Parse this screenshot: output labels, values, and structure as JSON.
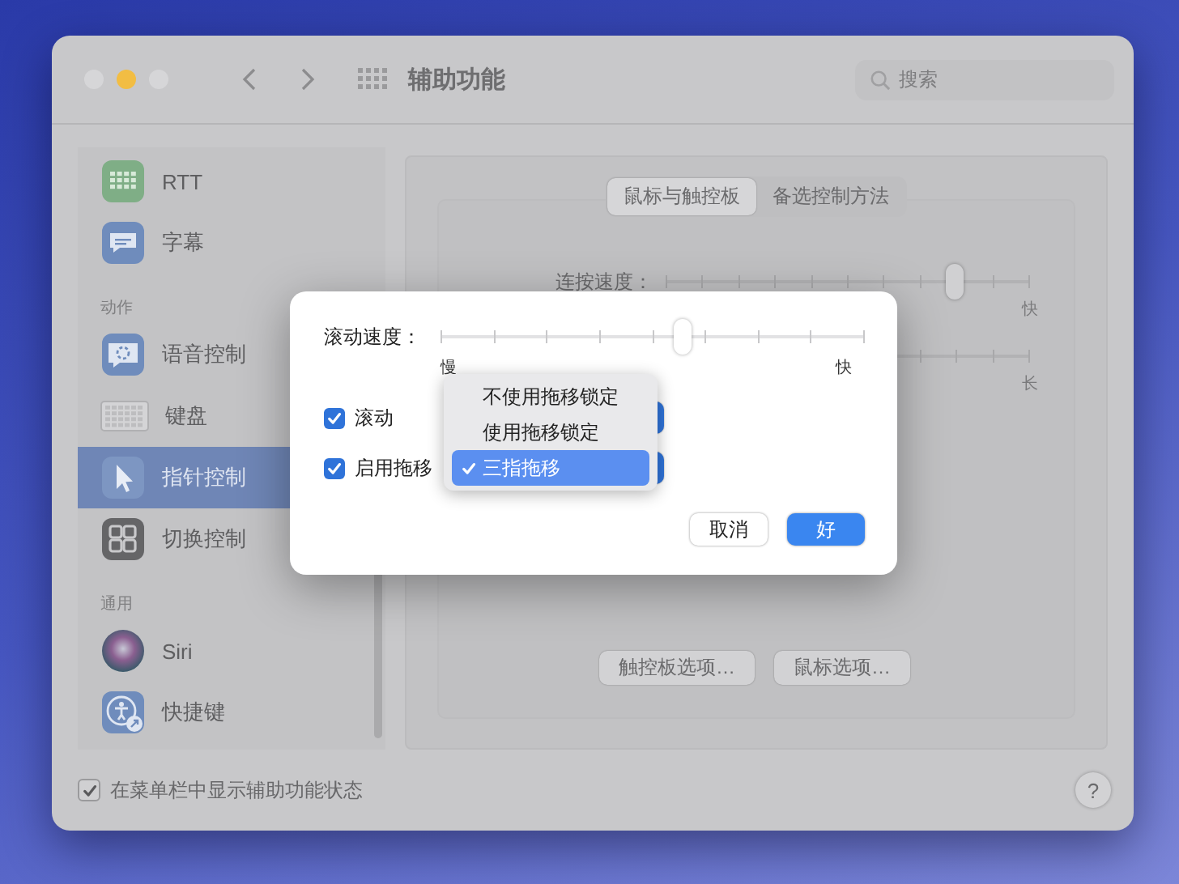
{
  "window": {
    "title": "辅助功能",
    "search": {
      "placeholder": "搜索"
    }
  },
  "sidebar": {
    "items": [
      {
        "kind": "item",
        "label": "RTT",
        "selected": false
      },
      {
        "kind": "item",
        "label": "字幕",
        "selected": false
      },
      {
        "kind": "header",
        "label": "动作"
      },
      {
        "kind": "item",
        "label": "语音控制",
        "selected": false
      },
      {
        "kind": "item",
        "label": "键盘",
        "selected": false
      },
      {
        "kind": "item",
        "label": "指针控制",
        "selected": true
      },
      {
        "kind": "item",
        "label": "切换控制",
        "selected": false
      },
      {
        "kind": "header",
        "label": "通用"
      },
      {
        "kind": "item",
        "label": "Siri",
        "selected": false
      },
      {
        "kind": "item",
        "label": "快捷键",
        "selected": false
      }
    ]
  },
  "panel": {
    "tabs": [
      {
        "label": "鼠标与触控板",
        "selected": true
      },
      {
        "label": "备选控制方法",
        "selected": false
      }
    ],
    "sliders": [
      {
        "label": "连按速度：",
        "level": 0.79,
        "end_label": "快"
      },
      {
        "end_label": "长"
      }
    ],
    "buttons": [
      "触控板选项…",
      "鼠标选项…"
    ]
  },
  "footer": {
    "checkbox": {
      "label": "在菜单栏中显示辅助功能状态",
      "checked": true
    },
    "help": "?"
  },
  "dialog": {
    "slider": {
      "label": "滚动速度：",
      "level": 0.57,
      "min_label": "慢",
      "max_label": "快"
    },
    "options": [
      {
        "label": "滚动",
        "checked": true
      },
      {
        "label": "启用拖移",
        "checked": true
      }
    ],
    "menu": [
      {
        "label": "不使用拖移锁定",
        "selected": false
      },
      {
        "label": "使用拖移锁定",
        "selected": false
      },
      {
        "label": "三指拖移",
        "selected": true
      }
    ],
    "buttons": [
      {
        "label": "取消",
        "kind": "secondary"
      },
      {
        "label": "好",
        "kind": "primary"
      }
    ]
  }
}
